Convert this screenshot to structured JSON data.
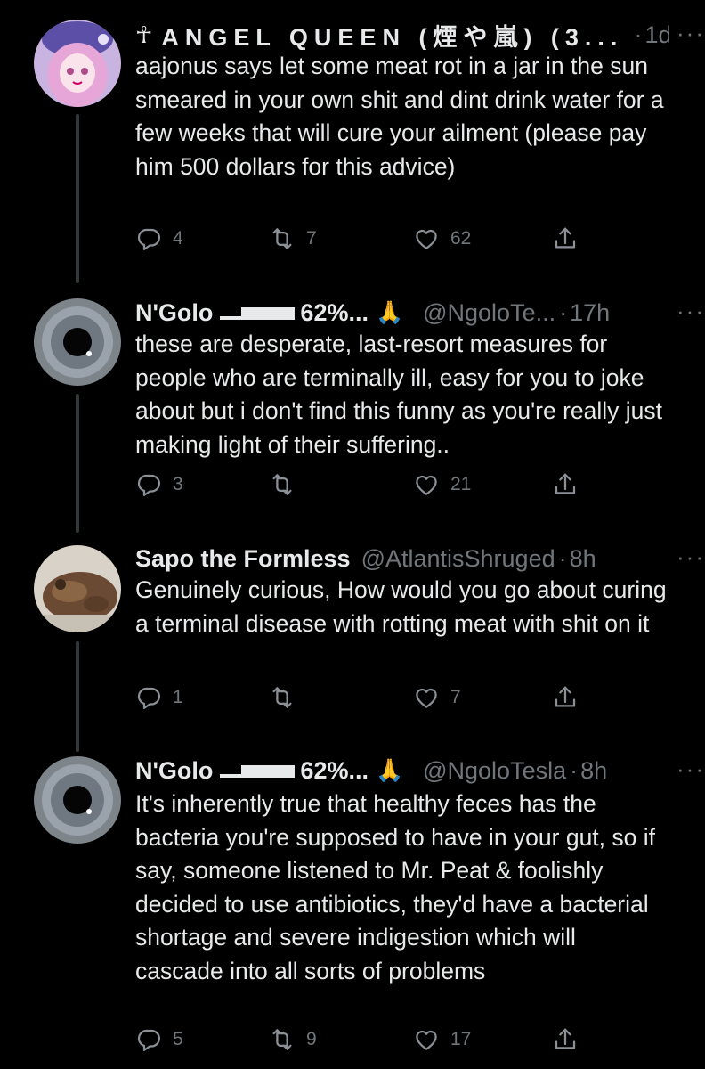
{
  "tweets": [
    {
      "name": "ANGEL QUEEN (煙や嵐) (3...",
      "name_prefix_icon": "ankh-symbol",
      "handle": "",
      "time": "1d",
      "text": "aajonus says let some meat rot in a jar in the sun smeared in your own shit and dint drink water for a few weeks that will cure your ailment (please pay him 500 dollars for this advice)",
      "replies": "4",
      "retweets": "7",
      "likes": "62",
      "avatar": "anime-girl-avatar"
    },
    {
      "name": "N'Golo",
      "name_suffix": "62%...",
      "name_emoji": "🙏",
      "handle": "@NgoloTe...",
      "time": "17h",
      "text": "these are desperate, last-resort measures for people who are terminally ill, easy for you to joke about but i don't find this funny as you're really just making light of their suffering..",
      "replies": "3",
      "retweets": "",
      "likes": "21",
      "avatar": "eye-avatar"
    },
    {
      "name": "Sapo the Formless",
      "handle": "@AtlantisShruged",
      "time": "8h",
      "text": "Genuinely curious, How would you go about curing a terminal disease with rotting meat with shit on it",
      "replies": "1",
      "retweets": "",
      "likes": "7",
      "avatar": "toad-avatar"
    },
    {
      "name": "N'Golo",
      "name_suffix": "62%...",
      "name_emoji": "🙏",
      "handle": "@NgoloTesla",
      "time": "8h",
      "text": "It's inherently true that healthy feces has the bacteria you're supposed to have in your gut, so if say, someone listened to Mr. Peat & foolishly decided to use antibiotics, they'd have a bacterial shortage and severe indigestion which will cascade into all sorts of problems",
      "replies": "5",
      "retweets": "9",
      "likes": "17",
      "avatar": "eye-avatar"
    }
  ],
  "more_label": "···",
  "time_separator": "·",
  "colors": {
    "background": "#000000",
    "text": "#e7e9ea",
    "muted": "#71767b",
    "thread_line": "#333639"
  }
}
